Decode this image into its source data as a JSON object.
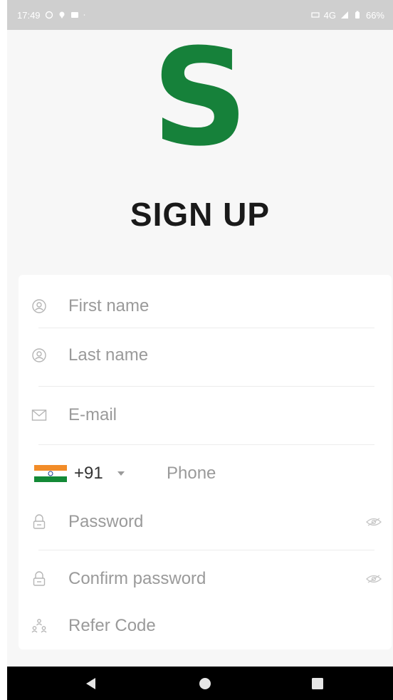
{
  "status_bar": {
    "time": "17:49",
    "right_text": "4G",
    "battery": "66%"
  },
  "logo": {
    "letter": "S",
    "color": "#16813a"
  },
  "page_title": "SIGN UP",
  "form": {
    "first_name": {
      "placeholder": "First name",
      "icon": "person-icon"
    },
    "last_name": {
      "placeholder": "Last name",
      "icon": "person-icon"
    },
    "email": {
      "placeholder": "E-mail",
      "icon": "mail-icon"
    },
    "phone": {
      "country_code": "+91",
      "country_flag": "india-flag-icon",
      "placeholder": "Phone"
    },
    "password": {
      "placeholder": "Password",
      "icon": "lock-icon",
      "toggle_icon": "eye-icon"
    },
    "confirm_password": {
      "placeholder": "Confirm password",
      "icon": "lock-icon",
      "toggle_icon": "eye-icon"
    },
    "refer_code": {
      "placeholder": "Refer Code",
      "icon": "people-icon"
    }
  },
  "nav_bar": {
    "back": "back-triangle-icon",
    "home": "home-circle-icon",
    "recents": "recents-square-icon"
  }
}
